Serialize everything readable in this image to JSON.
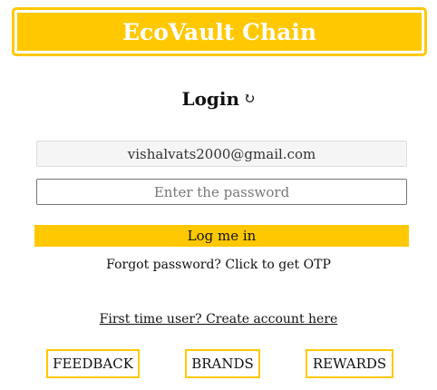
{
  "header": {
    "title": "EcoVault Chain"
  },
  "login": {
    "title": "Login",
    "refresh_icon": "refresh-icon",
    "refresh_glyph": "↻",
    "email_value": "vishalvats2000@gmail.com",
    "password_placeholder": "Enter the password",
    "submit_label": "Log me in",
    "forgot_text": "Forgot password? Click to get OTP",
    "create_account_text": "First time user? Create account here"
  },
  "nav": {
    "feedback_label": "FEEDBACK",
    "brands_label": "BRANDS",
    "rewards_label": "REWARDS"
  },
  "colors": {
    "accent": "#FFC800",
    "text": "#111111",
    "input_bg": "#F5F5F5"
  }
}
